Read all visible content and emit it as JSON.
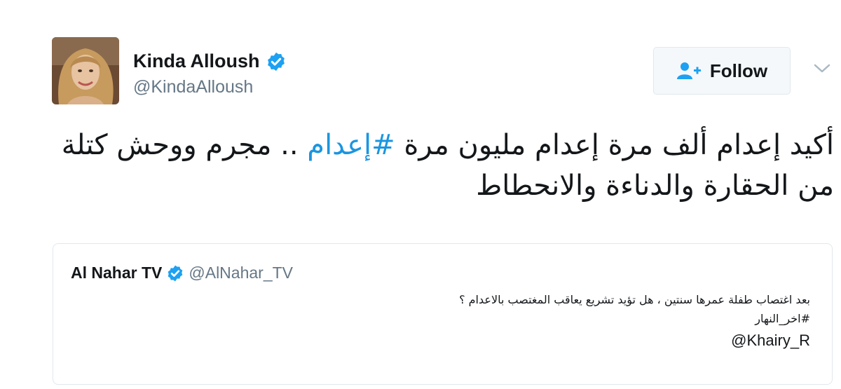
{
  "tweet": {
    "author": {
      "display_name": "Kinda Alloush",
      "handle": "@KindaAlloush",
      "verified": true
    },
    "follow_button": {
      "label": "Follow",
      "icon": "add-user-icon"
    },
    "more_menu_icon": "chevron-down-icon",
    "text": {
      "line1_before": "أكيد إعدام ألف مرة إعدام مليون مرة ",
      "hashtag": "#إعدام",
      "line1_after": " .. مجرم ووحش كتلة",
      "line2": "من الحقارة والدناءة والانحطاط"
    },
    "quoted_tweet": {
      "display_name": "Al Nahar TV",
      "handle": "@AlNahar_TV",
      "verified": true,
      "lines": [
        "بعد اغتصاب طفلة عمرها سنتين ، هل تؤيد تشريع يعاقب المغتصب بالاعدام ؟",
        "#اخر_النهار",
        "@Khairy_R"
      ]
    }
  },
  "colors": {
    "link": "#1b95e0",
    "verified": "#1da1f2",
    "secondary_text": "#657786",
    "border": "#e1e8ed"
  }
}
